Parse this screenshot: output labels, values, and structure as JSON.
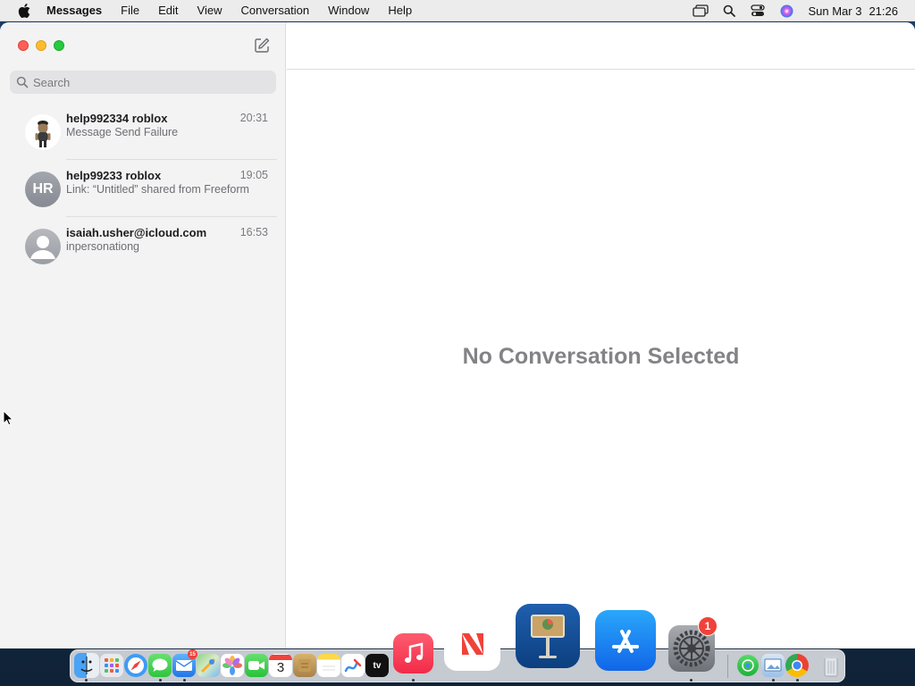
{
  "menubar": {
    "app_name": "Messages",
    "items": [
      "File",
      "Edit",
      "View",
      "Conversation",
      "Window",
      "Help"
    ],
    "status_icons": [
      "screen-mirroring-icon",
      "spotlight-search-icon",
      "control-center-icon",
      "siri-icon"
    ],
    "clock_day": "Sun Mar 3",
    "clock_time": "21:26"
  },
  "sidebar": {
    "search_placeholder": "Search",
    "conversations": [
      {
        "name": "help992334 roblox",
        "time": "20:31",
        "preview": "Message Send Failure",
        "avatar": "memoji"
      },
      {
        "name": "help99233 roblox",
        "time": "19:05",
        "preview": "Link: “Untitled” shared from Freeform",
        "avatar": "initials",
        "initials": "HR"
      },
      {
        "name": "isaiah.usher@icloud.com",
        "time": "16:53",
        "preview": "inpersonationg",
        "avatar": "generic"
      }
    ]
  },
  "main": {
    "empty_message": "No Conversation Selected"
  },
  "dock": {
    "apps": [
      "Finder",
      "Launchpad",
      "Safari",
      "Messages",
      "Mail",
      "Maps",
      "Photos",
      "FaceTime",
      "Calendar",
      "Notes",
      "Reminders",
      "Freeform",
      "TV",
      "Music",
      "News",
      "Keynote",
      "App Store",
      "System Settings",
      "Find My",
      "Preview",
      "Chrome",
      "Trash"
    ],
    "calendar_day": "3",
    "mail_badge": "15",
    "settings_badge": "1",
    "tv_label": "tv"
  },
  "colors": {
    "menubar_bg": "#ececec",
    "sidebar_bg": "#f3f3f4",
    "close": "#fe5f57",
    "minimize": "#febc2e",
    "zoom": "#28c840",
    "badge": "#f0423a"
  }
}
